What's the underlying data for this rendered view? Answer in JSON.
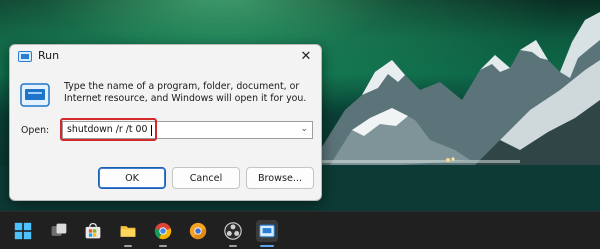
{
  "dialog": {
    "title": "Run",
    "description": "Type the name of a program, folder, document, or Internet resource, and Windows will open it for you.",
    "open_label": "Open:",
    "open_value": "shutdown /r /t 00",
    "buttons": {
      "ok": "OK",
      "cancel": "Cancel",
      "browse": "Browse..."
    }
  },
  "taskbar": {
    "icons": [
      "start-icon",
      "task-view-icon",
      "microsoft-store-icon",
      "file-explorer-icon",
      "chrome-icon",
      "chrome-canary-icon",
      "obs-studio-icon",
      "run-icon"
    ]
  },
  "colors": {
    "highlight": "#d22a2a",
    "accent": "#1c5fb0",
    "taskbar": "#202020"
  }
}
